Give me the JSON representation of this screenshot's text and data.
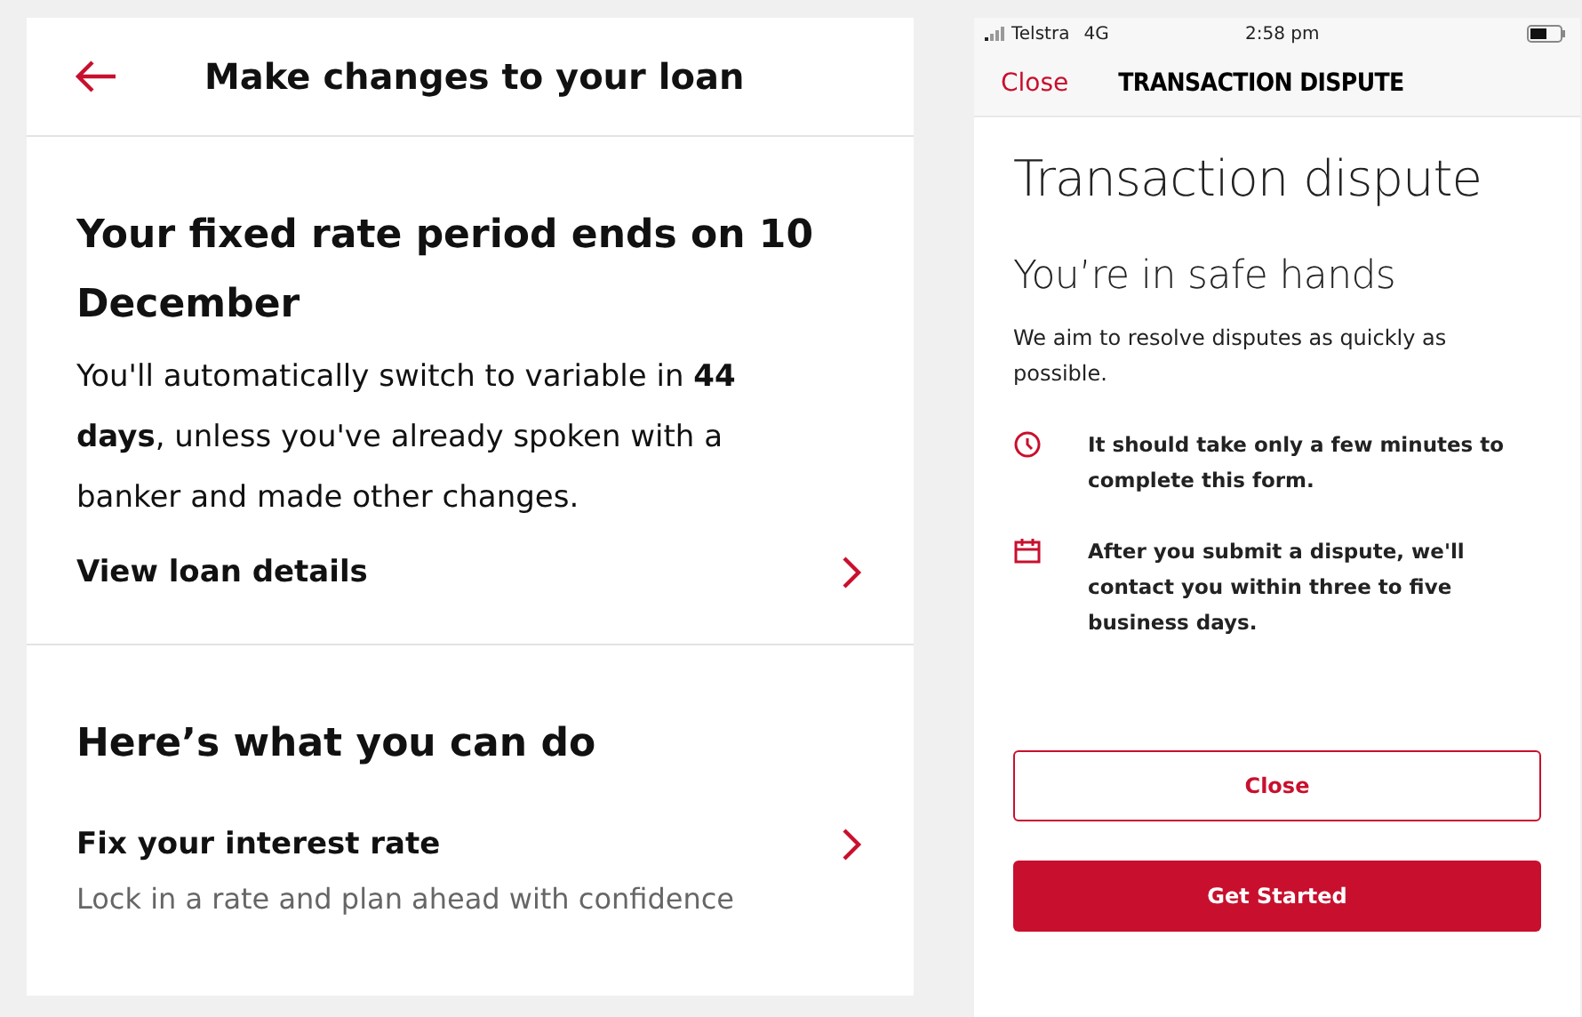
{
  "loan_screen": {
    "header": {
      "title": "Make changes to your loan"
    },
    "notice": {
      "title": "Your fixed rate period ends on 10 December",
      "body": "You'll automatically switch to variable in **44 days**, unless you've already spoken with a banker and made other changes.",
      "link": "View loan details"
    },
    "actions": {
      "title": "Here’s what you can do",
      "items": [
        {
          "title": "Fix your interest rate",
          "subtitle": "Lock in a rate and plan ahead with confidence"
        }
      ]
    }
  },
  "dispute_screen": {
    "status_bar": {
      "carrier": "Telstra",
      "network": "4G",
      "time": "2:58 pm"
    },
    "nav": {
      "close": "Close",
      "title": "TRANSACTION DISPUTE"
    },
    "heading": "Transaction dispute",
    "subheading": "You’re in safe hands",
    "intro": "We aim to resolve disputes as quickly as possible.",
    "points": [
      {
        "kind": "clock",
        "text": "It should take only a few minutes to complete this form."
      },
      {
        "kind": "calendar",
        "text": "After you submit a dispute, we'll contact you within three to five business days."
      }
    ],
    "buttons": [
      {
        "kind": "outline",
        "label": "Close"
      },
      {
        "kind": "primary",
        "label": "Get Started"
      }
    ]
  }
}
